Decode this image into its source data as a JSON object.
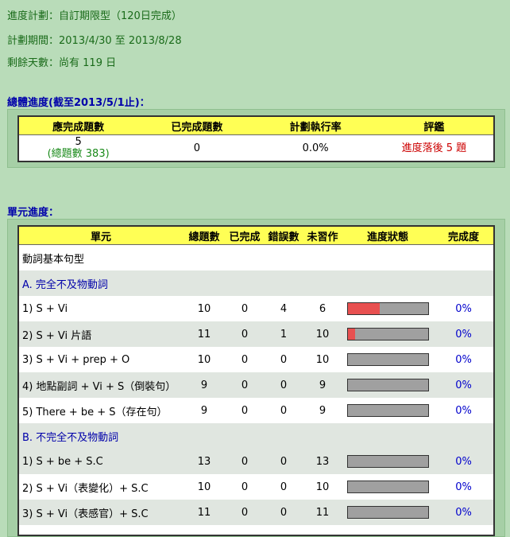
{
  "plan": {
    "type_label": "進度計劃：",
    "type_value": "自訂期限型（120日完成）",
    "period_label": "計劃期間：",
    "period_value": "2013/4/30 至 2013/8/28",
    "days_label": "剩餘天數：",
    "days_value": "尚有 119 日"
  },
  "overall": {
    "title": "總體進度(截至2013/5/1止)：",
    "headers": [
      "應完成題數",
      "已完成題數",
      "計劃執行率",
      "評鑑"
    ],
    "should_complete": "5",
    "total_note": "(總題數 383)",
    "completed": "0",
    "rate": "0.0%",
    "evaluation": "進度落後 5 題"
  },
  "units": {
    "title": "單元進度：",
    "headers": [
      "單元",
      "總題數",
      "已完成",
      "錯誤數",
      "未習作",
      "進度狀態",
      "完成度"
    ],
    "rows": [
      {
        "kind": "heading",
        "label": "動詞基本句型"
      },
      {
        "kind": "section",
        "label": "A. 完全不及物動詞"
      },
      {
        "kind": "item",
        "label": "1) S + Vi",
        "total": "10",
        "done": "0",
        "errors": "4",
        "todo": "6",
        "progress": 0.4,
        "pct": "0%"
      },
      {
        "kind": "item",
        "label": "2) S + Vi 片語",
        "total": "11",
        "done": "0",
        "errors": "1",
        "todo": "10",
        "progress": 0.09,
        "pct": "0%"
      },
      {
        "kind": "item",
        "label": "3) S + Vi + prep + O",
        "total": "10",
        "done": "0",
        "errors": "0",
        "todo": "10",
        "progress": 0,
        "pct": "0%"
      },
      {
        "kind": "item",
        "label": "4) 地點副詞 + Vi + S（倒裝句）",
        "total": "9",
        "done": "0",
        "errors": "0",
        "todo": "9",
        "progress": 0,
        "pct": "0%"
      },
      {
        "kind": "item",
        "label": "5) There + be + S（存在句）",
        "total": "9",
        "done": "0",
        "errors": "0",
        "todo": "9",
        "progress": 0,
        "pct": "0%"
      },
      {
        "kind": "section",
        "label": "B. 不完全不及物動詞"
      },
      {
        "kind": "item",
        "label": "1) S + be + S.C",
        "total": "13",
        "done": "0",
        "errors": "0",
        "todo": "13",
        "progress": 0,
        "pct": "0%"
      },
      {
        "kind": "item",
        "label": "2) S + Vi（表變化）+ S.C",
        "total": "10",
        "done": "0",
        "errors": "0",
        "todo": "10",
        "progress": 0,
        "pct": "0%"
      },
      {
        "kind": "item",
        "label": "3) S + Vi（表感官）+ S.C",
        "total": "11",
        "done": "0",
        "errors": "0",
        "todo": "11",
        "progress": 0,
        "pct": "0%"
      }
    ]
  },
  "colors": {
    "background": "#b9dcb9",
    "header_yellow": "#ffff55",
    "bar_fill": "#e85050",
    "bar_empty": "#a0a0a0"
  }
}
